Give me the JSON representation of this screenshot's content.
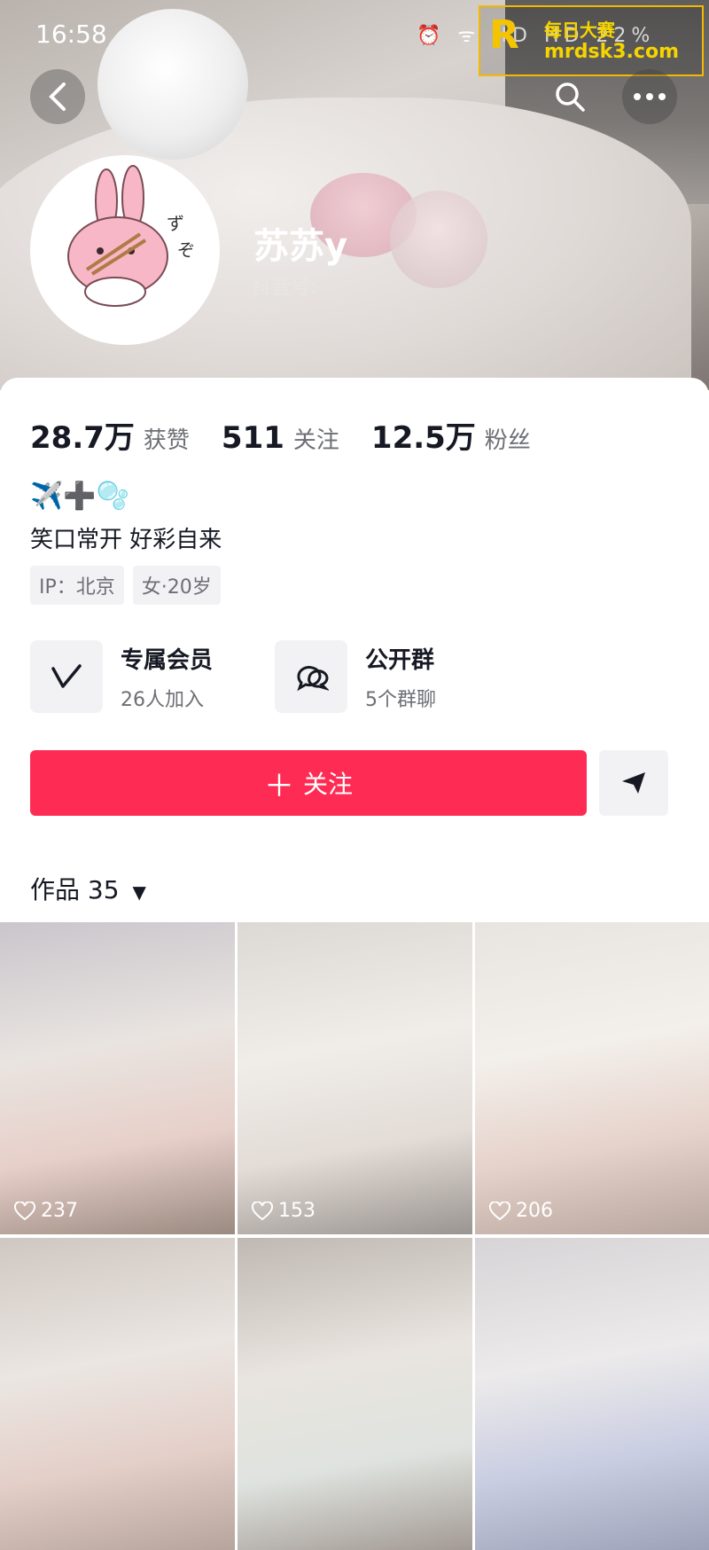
{
  "status_bar": {
    "time": "16:58",
    "icons_text": "⏰ ᯤ HD HD 22%"
  },
  "watermark": {
    "logo": "R",
    "line1": "每日大赛",
    "line2": "mrdsk3.com"
  },
  "header": {
    "nickname": "苏苏y",
    "douyin_id_label": "抖音号:",
    "back_icon": "back-arrow-icon",
    "search_icon": "search-icon",
    "more_icon": "more-icon",
    "avatar_icon": "bunny-eating-noodles-sticker"
  },
  "stats": [
    {
      "num": "28.7万",
      "label": "获赞"
    },
    {
      "num": "511",
      "label": "关注"
    },
    {
      "num": "12.5万",
      "label": "粉丝"
    }
  ],
  "bio": {
    "emoji": "✈️➕🫧",
    "text": "笑口常开 好彩自来"
  },
  "tags": [
    "IP：北京",
    "女·20岁"
  ],
  "features": [
    {
      "title": "专属会员",
      "sub": "26人加入",
      "icon": "membership-v-icon"
    },
    {
      "title": "公开群",
      "sub": "5个群聊",
      "icon": "group-chat-icon"
    }
  ],
  "actions": {
    "follow_label": "关注",
    "share_icon": "share-arrow-icon"
  },
  "works": {
    "label": "作品 35"
  },
  "videos": [
    {
      "likes": "237"
    },
    {
      "likes": "153"
    },
    {
      "likes": "206"
    },
    {
      "likes": ""
    },
    {
      "likes": ""
    },
    {
      "likes": ""
    }
  ],
  "colors": {
    "primary": "#fe2c55",
    "text": "#161823",
    "secondary_text": "#6e6f75",
    "chip_bg": "#f2f2f4"
  }
}
